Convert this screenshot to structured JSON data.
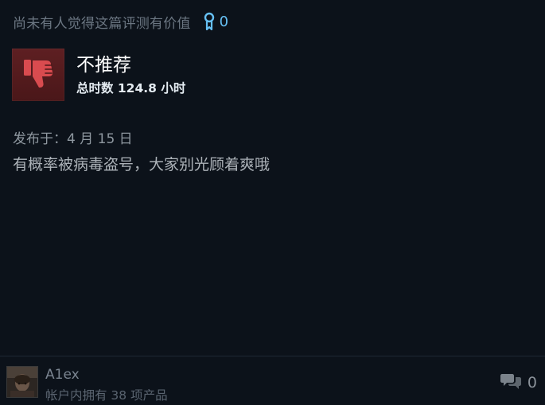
{
  "review": {
    "helpful_text": "尚未有人觉得这篇评测有价值",
    "award_count": "0",
    "recommendation": "不推荐",
    "hours_played": "总时数 124.8 小时",
    "posted_date": "发布于：4 月 15 日",
    "body": "有概率被病毒盗号，大家别光顾着爽哦"
  },
  "author": {
    "name": "A1ex",
    "games_owned": "帐户内拥有 38 项产品"
  },
  "comments": {
    "count": "0"
  },
  "icons": {
    "award": "award-ribbon-icon",
    "thumb": "thumbs-down-icon",
    "comment": "comment-bubbles-icon"
  },
  "colors": {
    "background": "#0c121a",
    "accent_blue": "#66c0f4",
    "thumb_red": "#d94b4f",
    "thumb_box": "#5e1f22"
  }
}
